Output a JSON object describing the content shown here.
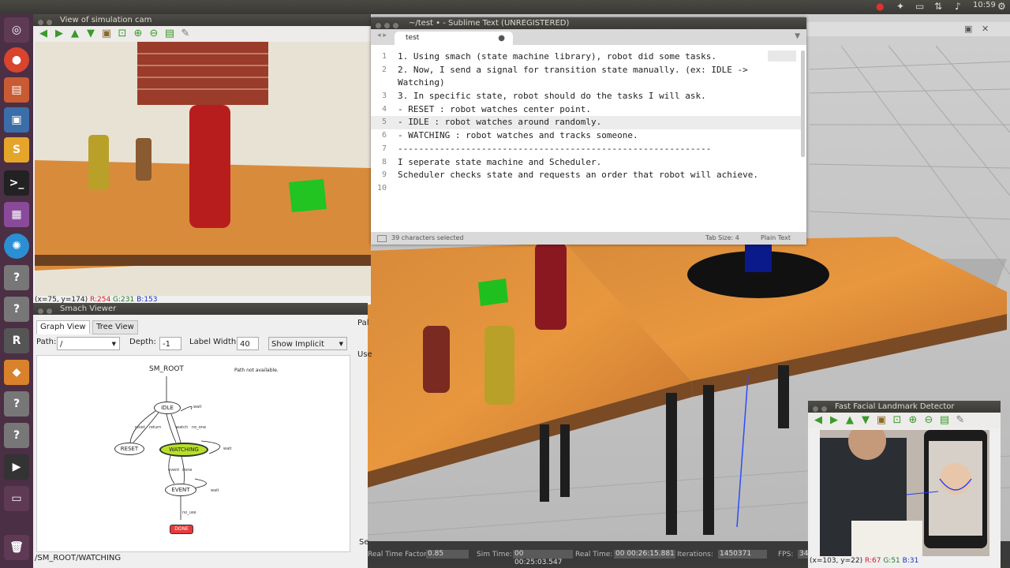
{
  "topbar": {
    "time": "10:59"
  },
  "simcam": {
    "title": "View of simulation cam",
    "status": {
      "coord": "(x=75, y=174)",
      "r": "R:254",
      "g": "G:231",
      "b": "B:153"
    }
  },
  "sublime": {
    "title": "~/test • - Sublime Text (UNREGISTERED)",
    "tab_label": "test",
    "tab_dirty": "●",
    "lines": [
      {
        "n": "1",
        "text": "1. Using smach (state machine library), robot did some tasks."
      },
      {
        "n": "2",
        "text": "2. Now, I send a signal for transition state manually. (ex: IDLE ->"
      },
      {
        "n": "",
        "text": "Watching)"
      },
      {
        "n": "3",
        "text": "3. In specific state, robot should do the tasks I will ask."
      },
      {
        "n": "4",
        "text": "- RESET : robot watches center point."
      },
      {
        "n": "5",
        "text": "- IDLE : robot watches around randomly."
      },
      {
        "n": "6",
        "text": "- WATCHING : robot watches and tracks someone."
      },
      {
        "n": "7",
        "text": "------------------------------------------------------------"
      },
      {
        "n": "8",
        "text": "I seperate state machine and Scheduler."
      },
      {
        "n": "9",
        "text": "Scheduler checks state and requests an order that robot will achieve."
      },
      {
        "n": "10",
        "text": ""
      }
    ],
    "status_left": "39 characters selected",
    "tab_size": "Tab Size: 4",
    "syntax": "Plain Text"
  },
  "smach": {
    "title": "Smach Viewer",
    "tabs": [
      "Graph View",
      "Tree View"
    ],
    "path_label": "Path:",
    "path_value": "/",
    "depth_label": "Depth:",
    "depth_value": "-1",
    "width_label": "Label Width:",
    "width_value": "40",
    "show_implicit": "Show Implicit",
    "root": "SM_ROOT",
    "path_note": "Path not available.",
    "nodes": {
      "idle": "IDLE",
      "reset": "RESET",
      "watching": "WATCHING",
      "event": "EVENT",
      "done": "DONE"
    },
    "edges": {
      "wait": "wait",
      "reset": "reset",
      "return": "return",
      "watch": "watch",
      "no_one": "no_one",
      "event": "event",
      "done": "done",
      "no_use": "no_use"
    },
    "status_path": "/SM_ROOT/WATCHING",
    "side_labels": [
      "Pal",
      "Use",
      "Se"
    ]
  },
  "gazebo": {
    "rtf_label": "Real Time Factor:",
    "rtf": "0.85",
    "sim_label": "Sim Time:",
    "sim": "00 00:25:03.547",
    "real_label": "Real Time:",
    "real": "00 00:26:15.881",
    "iter_label": "Iterations:",
    "iter": "1450371",
    "fps_label": "FPS:",
    "fps": "34"
  },
  "face": {
    "title": "Fast Facial Landmark Detector",
    "status": {
      "coord": "(x=103, y=22)",
      "r": "R:67",
      "g": "G:51",
      "b": "B:31"
    }
  },
  "colors": {
    "watching": "#b8e02a",
    "done": "#e83a3a",
    "launcher": "#4b2f44"
  }
}
